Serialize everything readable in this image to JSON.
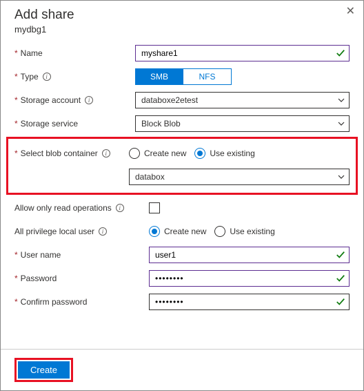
{
  "panel": {
    "title": "Add share",
    "subtitle": "mydbg1"
  },
  "labels": {
    "name": "Name",
    "type": "Type",
    "storage_account": "Storage account",
    "storage_service": "Storage service",
    "select_container": "Select blob container",
    "allow_read": "Allow only read operations",
    "priv_user": "All privilege local user",
    "user_name": "User name",
    "password": "Password",
    "confirm_password": "Confirm password"
  },
  "values": {
    "name": "myshare1",
    "storage_account": "databoxe2etest",
    "storage_service": "Block Blob",
    "container": "databox",
    "user_name": "user1",
    "password": "••••••••",
    "confirm_password": "••••••••"
  },
  "type_options": {
    "smb": "SMB",
    "nfs": "NFS",
    "selected": "smb"
  },
  "container_radio": {
    "create": "Create new",
    "existing": "Use existing",
    "selected": "existing"
  },
  "user_radio": {
    "create": "Create new",
    "existing": "Use existing",
    "selected": "create"
  },
  "buttons": {
    "create": "Create"
  }
}
